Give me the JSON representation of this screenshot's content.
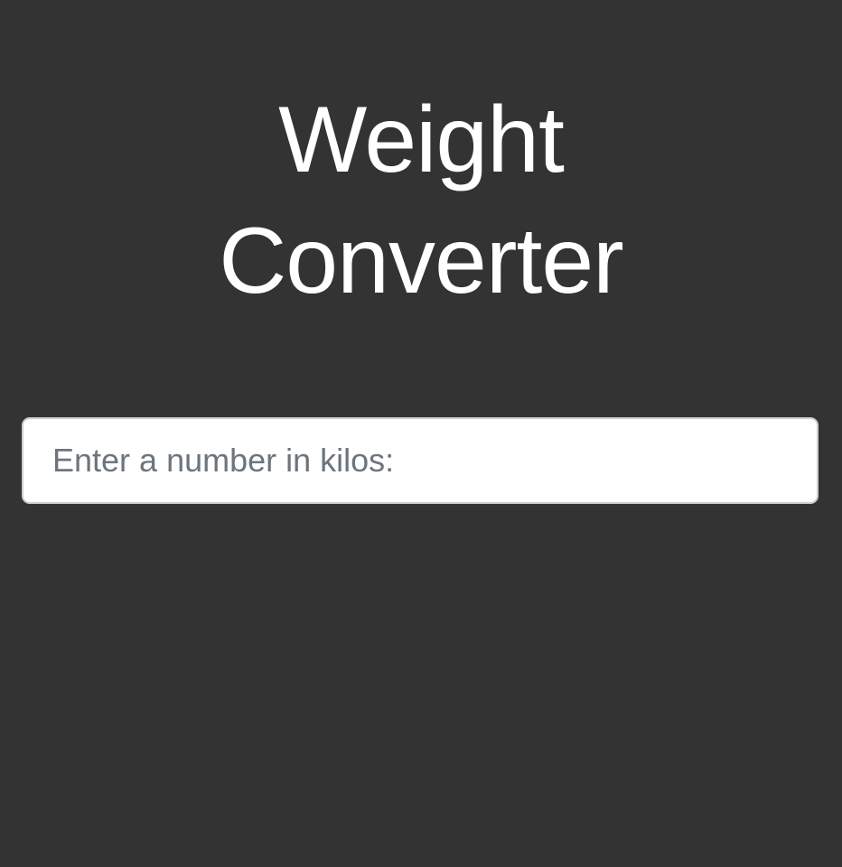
{
  "header": {
    "title_line1": "Weight",
    "title_line2": "Converter"
  },
  "form": {
    "kilos_input": {
      "value": "",
      "placeholder": "Enter a number in kilos:"
    }
  },
  "colors": {
    "background": "#333333",
    "title_text": "#ffffff",
    "input_background": "#ffffff",
    "input_border": "#c9ced3",
    "placeholder_text": "#6c757d"
  }
}
